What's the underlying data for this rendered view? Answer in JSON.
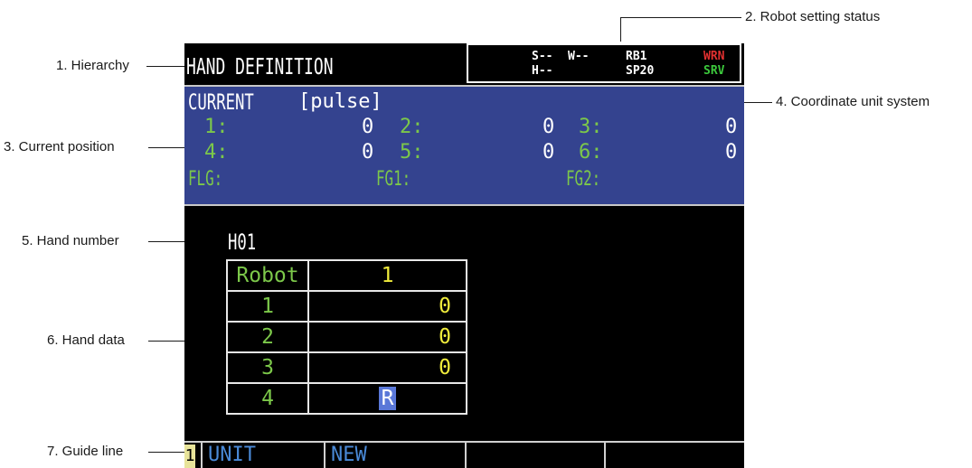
{
  "callouts": {
    "hierarchy": "1. Hierarchy",
    "robot_setting_status": "2. Robot setting status",
    "current_position": "3. Current position",
    "coordinate_unit_system": "4. Coordinate unit system",
    "hand_number": "5. Hand number",
    "hand_data": "6. Hand data",
    "guide_line": "7. Guide line"
  },
  "header": {
    "title": "HAND DEFINITION"
  },
  "status": {
    "s": "S--",
    "w": "W--",
    "h": "H--",
    "robot": "RB1",
    "speed": "SP20",
    "warn": "WRN",
    "servo": "SRV",
    "colors": {
      "normal": "#ffffff",
      "warn": "#e23030",
      "servo": "#3cc83c"
    }
  },
  "current": {
    "label": "CURRENT",
    "unit": "[pulse]",
    "axes": [
      {
        "label": "1:",
        "value": "0"
      },
      {
        "label": "2:",
        "value": "0"
      },
      {
        "label": "3:",
        "value": "0"
      },
      {
        "label": "4:",
        "value": "0"
      },
      {
        "label": "5:",
        "value": "0"
      },
      {
        "label": "6:",
        "value": "0"
      }
    ],
    "flags": {
      "flg": "FLG:",
      "fg1": "FG1:",
      "fg2": "FG2:"
    }
  },
  "hand": {
    "number": "H01",
    "rows": [
      {
        "label": "Robot",
        "value": "1"
      },
      {
        "label": "1",
        "value": "0"
      },
      {
        "label": "2",
        "value": "0"
      },
      {
        "label": "3",
        "value": "0"
      },
      {
        "label": "4",
        "value": "R"
      }
    ]
  },
  "guide": {
    "page": "1",
    "items": [
      "UNIT",
      "NEW",
      "",
      ""
    ]
  }
}
